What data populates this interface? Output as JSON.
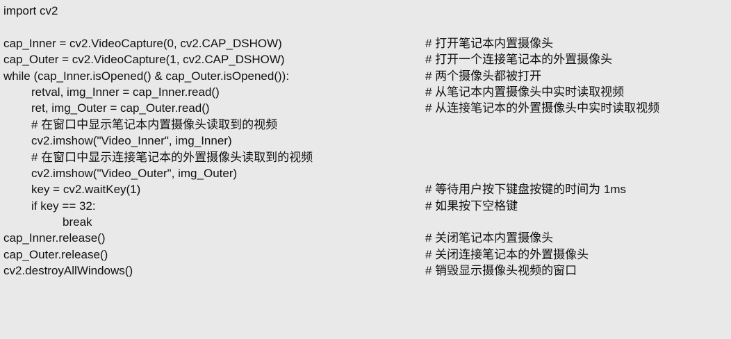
{
  "code": {
    "lines": [
      {
        "code": "import cv2",
        "comment": ""
      },
      {
        "code": "",
        "comment": ""
      },
      {
        "code": "cap_Inner = cv2.VideoCapture(0, cv2.CAP_DSHOW)",
        "comment": "# 打开笔记本内置摄像头"
      },
      {
        "code": "cap_Outer = cv2.VideoCapture(1, cv2.CAP_DSHOW)",
        "comment": "# 打开一个连接笔记本的外置摄像头"
      },
      {
        "code": "while (cap_Inner.isOpened() & cap_Outer.isOpened()):",
        "comment": "# 两个摄像头都被打开"
      },
      {
        "code": "retval, img_Inner = cap_Inner.read()",
        "comment": "# 从笔记本内置摄像头中实时读取视频"
      },
      {
        "code": "ret, img_Outer = cap_Outer.read()",
        "comment": "# 从连接笔记本的外置摄像头中实时读取视频"
      },
      {
        "code": "# 在窗口中显示笔记本内置摄像头读取到的视频",
        "comment": ""
      },
      {
        "code": "cv2.imshow(\"Video_Inner\", img_Inner)",
        "comment": ""
      },
      {
        "code": "# 在窗口中显示连接笔记本的外置摄像头读取到的视频",
        "comment": ""
      },
      {
        "code": "cv2.imshow(\"Video_Outer\", img_Outer)",
        "comment": ""
      },
      {
        "code": "key = cv2.waitKey(1)",
        "comment": "# 等待用户按下键盘按键的时间为 1ms"
      },
      {
        "code": "if key == 32:",
        "comment": "# 如果按下空格键"
      },
      {
        "code": "break",
        "comment": ""
      },
      {
        "code": "cap_Inner.release()",
        "comment": "# 关闭笔记本内置摄像头"
      },
      {
        "code": "cap_Outer.release()",
        "comment": "# 关闭连接笔记本的外置摄像头"
      },
      {
        "code": "cv2.destroyAllWindows()",
        "comment": "# 销毁显示摄像头视频的窗口"
      }
    ]
  }
}
